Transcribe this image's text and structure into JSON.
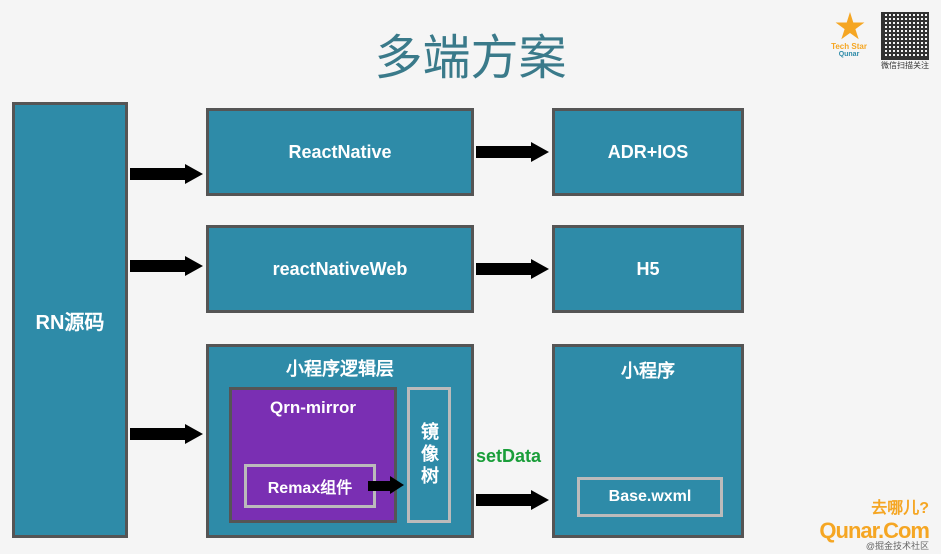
{
  "title": "多端方案",
  "source": "RN源码",
  "rows": [
    {
      "middle": "ReactNative",
      "target": "ADR+IOS"
    },
    {
      "middle": "reactNativeWeb",
      "target": "H5"
    }
  ],
  "logic": {
    "title": "小程序逻辑层",
    "qrn": "Qrn-mirror",
    "remax": "Remax组件",
    "mirror": "镜像树"
  },
  "mini": {
    "title": "小程序",
    "base": "Base.wxml"
  },
  "setData": "setData",
  "branding": {
    "techStar": "Tech Star",
    "techStarSub": "Qunar",
    "qrCaption": "微信扫描关注",
    "logoZh": "去哪儿?",
    "logoEn": "Qunar.Com",
    "footer": "@掘金技术社区"
  }
}
